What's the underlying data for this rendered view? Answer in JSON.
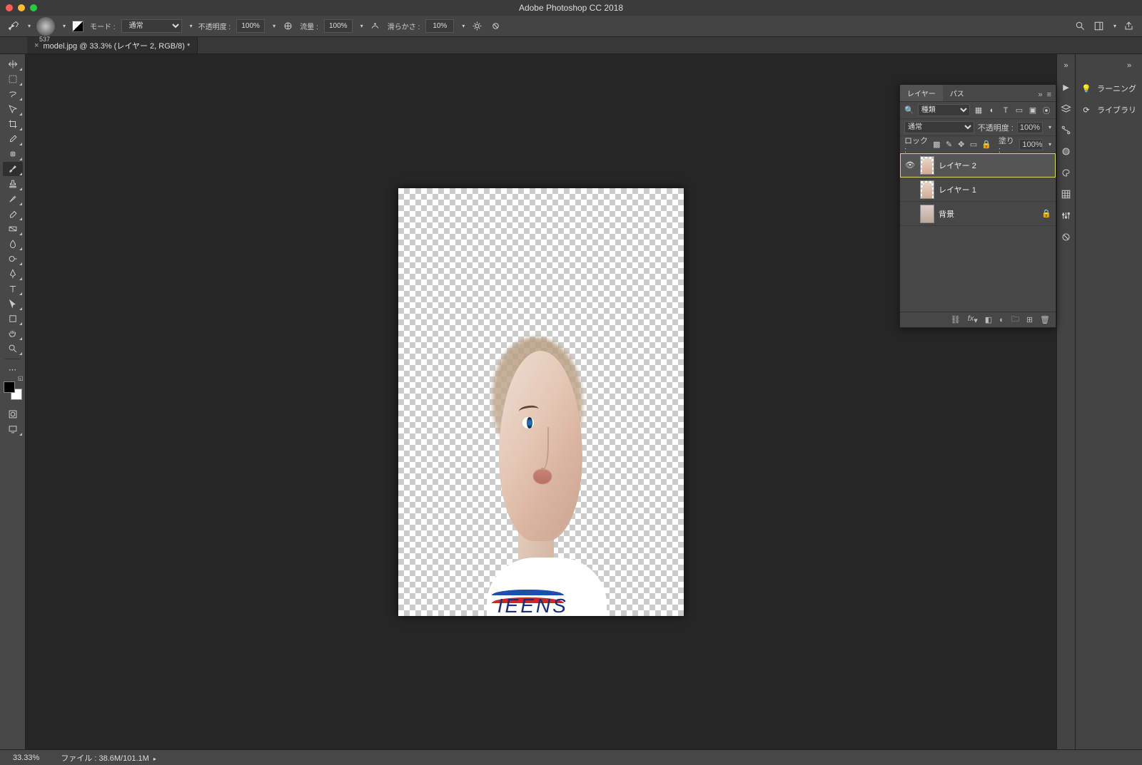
{
  "app": {
    "title": "Adobe Photoshop CC 2018"
  },
  "document": {
    "tab_label": "model.jpg @ 33.3% (レイヤー 2, RGB/8) *"
  },
  "options": {
    "brush_size": "537",
    "mode_label": "モード :",
    "mode_value": "通常",
    "opacity_label": "不透明度 :",
    "opacity_value": "100%",
    "flow_label": "流量 :",
    "flow_value": "100%",
    "smoothing_label": "滑らかさ :",
    "smoothing_value": "10%"
  },
  "right_dock_thin": [
    "chevrons",
    "play",
    "layers",
    "nodes",
    "color",
    "swatches",
    "grid",
    "adjust",
    "circle"
  ],
  "right_dock_wide": [
    {
      "icon": "💡",
      "label": "ラーニング"
    },
    {
      "icon": "⟳",
      "label": "ライブラリ"
    }
  ],
  "layers_panel": {
    "tabs": [
      "レイヤー",
      "パス"
    ],
    "kind_placeholder": "種類",
    "blend_mode": "通常",
    "opacity_label": "不透明度 :",
    "opacity_value": "100%",
    "lock_label": "ロック :",
    "fill_label": "塗り :",
    "fill_value": "100%",
    "layers": [
      {
        "visible": true,
        "name": "レイヤー 2",
        "selected": true,
        "locked": false
      },
      {
        "visible": false,
        "name": "レイヤー 1",
        "selected": false,
        "locked": false
      },
      {
        "visible": false,
        "name": "背景",
        "selected": false,
        "locked": true
      }
    ]
  },
  "status": {
    "zoom": "33.33%",
    "file_info": "ファイル : 38.6M/101.1M"
  },
  "canvas": {
    "shirt_text": "IEENS"
  }
}
